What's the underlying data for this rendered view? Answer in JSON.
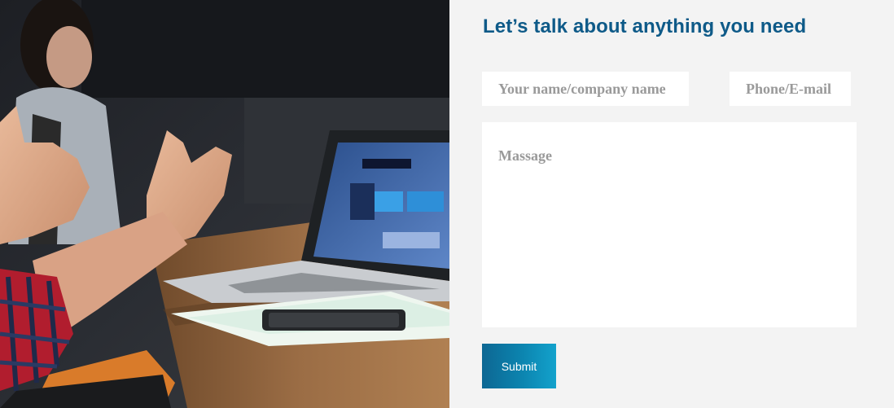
{
  "contact_form": {
    "heading": "Let’s talk about anything you need",
    "name_placeholder": "Your name/company name",
    "contact_placeholder": "Phone/E-mail",
    "message_placeholder": "Massage",
    "submit_label": "Submit",
    "colors": {
      "heading": "#0e5a88",
      "button_start": "#0d6793",
      "button_end": "#13a2cc",
      "panel_bg": "#f3f3f3"
    }
  },
  "hero_image": {
    "description_icon": "meeting-photo"
  }
}
